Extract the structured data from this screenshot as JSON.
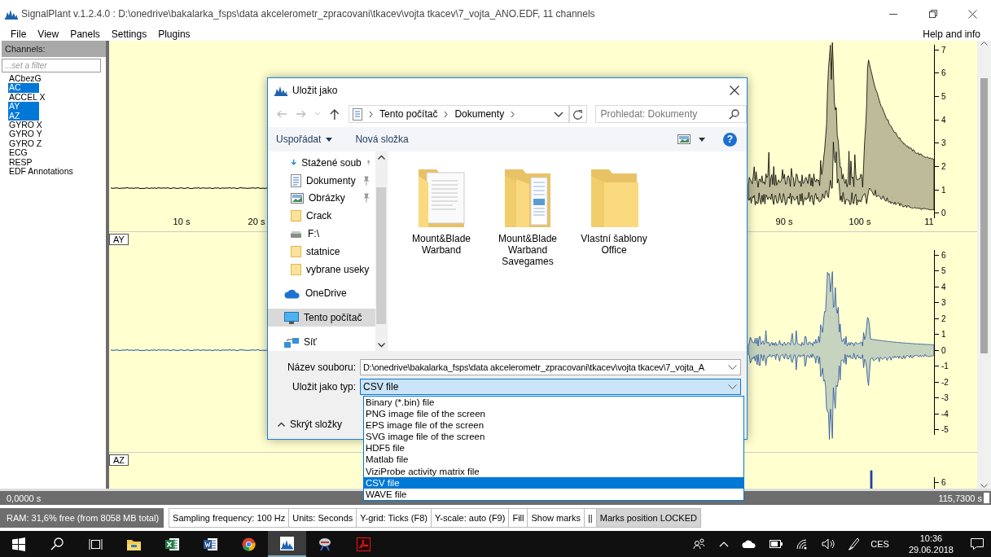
{
  "window": {
    "title": "SignalPlant v.1.2.4.0 : D:\\onedrive\\bakalarka_fsps\\data akcelerometr_zpracovani\\tkacev\\vojta tkacev\\7_vojta_ANO.EDF, 11 channels"
  },
  "menu": [
    "File",
    "View",
    "Panels",
    "Settings",
    "Plugins"
  ],
  "help_menu": "Help and info",
  "channels": {
    "header": "Channels:",
    "filter_placeholder": "...set a filter",
    "items": [
      {
        "name": "ACbezG",
        "selected": false
      },
      {
        "name": "AC",
        "selected": true
      },
      {
        "name": "ACCEL X",
        "selected": false
      },
      {
        "name": "AY",
        "selected": true
      },
      {
        "name": "AZ",
        "selected": true
      },
      {
        "name": "GYRO X",
        "selected": false
      },
      {
        "name": "GYRO Y",
        "selected": false
      },
      {
        "name": "GYRO Z",
        "selected": false
      },
      {
        "name": "ECG",
        "selected": false
      },
      {
        "name": "RESP",
        "selected": false
      },
      {
        "name": "EDF Annotations",
        "selected": false
      }
    ]
  },
  "plots": [
    {
      "kind": "envelope_decay",
      "color": "#000000",
      "x_ticks": [
        "10 s",
        "20 s",
        "90 s",
        "100 s",
        "11"
      ],
      "y_ticks": [
        "7",
        "6",
        "5",
        "4",
        "3",
        "2",
        "1",
        "0"
      ]
    },
    {
      "kind": "oscillation",
      "label": "AY",
      "color": "#1f4f9f",
      "y_ticks": [
        "6",
        "5",
        "4",
        "3",
        "2",
        "1",
        "0",
        "-1",
        "-2",
        "-3",
        "-4",
        "-5"
      ]
    },
    {
      "kind": "spikes",
      "label": "AZ",
      "color": "#1f3fa8",
      "y_ticks": [
        "6"
      ]
    }
  ],
  "time_bar": {
    "start": "0,0000 s",
    "end": "115,7300 s"
  },
  "status_bar": {
    "ram": "RAM: 31,6% free (from 8058 MB total)",
    "items": [
      "Sampling frequency: 100 Hz",
      "Units: Seconds",
      "Y-grid:  Ticks (F8)",
      "Y-scale: auto (F9)",
      "Fill",
      "Show marks",
      "||"
    ],
    "lock": "Marks position LOCKED"
  },
  "dialog": {
    "title": "Uložit jako",
    "breadcrumb": [
      "Tento počítač",
      "Dokumenty"
    ],
    "search_placeholder": "Prohledat: Dokumenty",
    "organize": "Uspořádat",
    "new_folder": "Nová složka",
    "help": "?",
    "nav": [
      {
        "label": "Stažené soub",
        "kind": "download",
        "pinned": true,
        "selected": false
      },
      {
        "label": "Dokumenty",
        "kind": "documents",
        "pinned": true,
        "selected": false
      },
      {
        "label": "Obrázky",
        "kind": "pictures",
        "pinned": true,
        "selected": false
      },
      {
        "label": "Crack",
        "kind": "folder",
        "pinned": false,
        "selected": false
      },
      {
        "label": "F:\\",
        "kind": "drive",
        "pinned": false,
        "selected": false
      },
      {
        "label": "statnice",
        "kind": "folder",
        "pinned": false,
        "selected": false
      },
      {
        "label": "vybrane useky",
        "kind": "folder",
        "pinned": false,
        "selected": false
      },
      {
        "label": "OneDrive",
        "kind": "cloud",
        "pinned": false,
        "selected": false
      },
      {
        "label": "Tento počítač",
        "kind": "computer",
        "pinned": false,
        "selected": true
      },
      {
        "label": "Síť",
        "kind": "network",
        "pinned": false,
        "selected": false
      }
    ],
    "files": [
      {
        "name": "Mount&Blade Warband",
        "kind": "document_folder"
      },
      {
        "name": "Mount&Blade Warband Savegames",
        "kind": "pages_folder"
      },
      {
        "name": "Vlastní šablony Office",
        "kind": "folder"
      }
    ],
    "filename_label": "Název souboru:",
    "filename": "D:\\onedrive\\bakalarka_fsps\\data akcelerometr_zpracovani\\tkacev\\vojta tkacev\\7_vojta_A",
    "type_label": "Uložit jako typ:",
    "type_value": "CSV file",
    "hide_folders": "Skrýt složky",
    "type_options": [
      {
        "label": "Binary (*.bin) file",
        "selected": false
      },
      {
        "label": "PNG image file of the screen",
        "selected": false
      },
      {
        "label": "EPS image file of the screen",
        "selected": false
      },
      {
        "label": "SVG image file of the screen",
        "selected": false
      },
      {
        "label": "HDF5 file",
        "selected": false
      },
      {
        "label": "Matlab file",
        "selected": false
      },
      {
        "label": "ViziProbe activity matrix file",
        "selected": false
      },
      {
        "label": "CSV file",
        "selected": true
      },
      {
        "label": "WAVE file",
        "selected": false
      }
    ]
  },
  "taskbar": {
    "apps": [
      {
        "kind": "start",
        "active": false
      },
      {
        "kind": "search",
        "active": false
      },
      {
        "kind": "taskview",
        "active": false
      },
      {
        "kind": "explorer",
        "active": false
      },
      {
        "kind": "sheet",
        "active": false
      },
      {
        "kind": "writer",
        "active": false
      },
      {
        "kind": "browser",
        "active": false
      },
      {
        "kind": "signal",
        "active": true
      },
      {
        "kind": "tool",
        "active": false
      },
      {
        "kind": "pdf",
        "active": false
      }
    ],
    "language": "CES",
    "time": "10:36",
    "date": "29.06.2018"
  }
}
